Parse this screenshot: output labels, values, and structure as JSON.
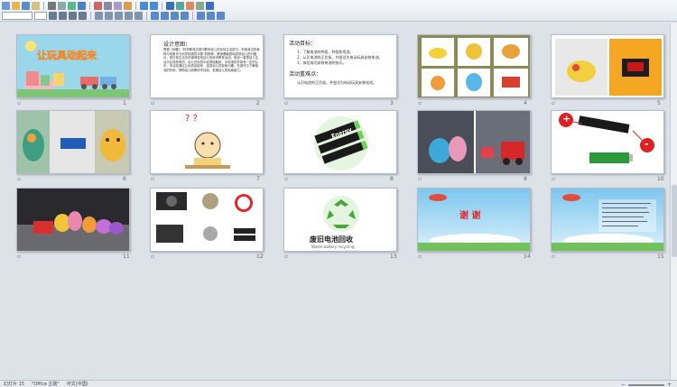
{
  "toolbar": {
    "row1_icons": [
      "new-icon",
      "open-icon",
      "save-icon",
      "mail-icon",
      "print-icon",
      "print-preview-icon",
      "spell-icon",
      "research-icon",
      "cut-icon",
      "copy-icon",
      "paste-icon",
      "format-painter-icon",
      "undo-icon",
      "redo-icon",
      "hyperlink-icon",
      "table-icon",
      "chart-icon",
      "zoom-icon",
      "help-icon"
    ],
    "row2_icons": [
      "bold-icon",
      "italic-icon",
      "underline-icon",
      "shadow-icon",
      "align-left-icon",
      "align-center-icon",
      "align-right-icon",
      "numbering-icon",
      "bullets-icon",
      "font-size-up-icon",
      "font-size-down-icon",
      "indent-icon",
      "outdent-icon",
      "font-color-icon",
      "design-icon",
      "new-slide-icon"
    ]
  },
  "slides": [
    {
      "num": "1",
      "title": "让玩具动起来"
    },
    {
      "num": "2",
      "heading": "设计意图：",
      "body": "根据《纲要》\"科学教育应密切联系幼儿的实际生活进行，利用身边的事物与现象作为科学探索的对象\"的精神，教师要敏锐地发现幼儿的兴趣点，把日常生活中的事情变成幼儿的科学教育活动。电池一直是幼儿生活中比较熟悉的，幼儿在玩具中经常接触到，对电池的作用有一定的认识，本活动通过让玩具动起来，激发幼儿的探索兴趣，在操作中了解电池的作用，帮助幼儿积累科学经验，发展幼儿的探索能力。"
    },
    {
      "num": "3",
      "heading": "活动目标：",
      "items": [
        "1、了解电池的种类、种类和用途。",
        "2、认识电池的正负极，并尝试为电动玩具安装电池。",
        "3、体验成功安装电池的快乐。"
      ],
      "heading2": "活动重难点：",
      "body2": "认识电池的正负极，并尝试为电动玩具安装电池。"
    },
    {
      "num": "4"
    },
    {
      "num": "5"
    },
    {
      "num": "6"
    },
    {
      "num": "7",
      "text": "? ?"
    },
    {
      "num": "8",
      "label": "Energy"
    },
    {
      "num": "9"
    },
    {
      "num": "10",
      "plus": "+",
      "minus": "-"
    },
    {
      "num": "11"
    },
    {
      "num": "12"
    },
    {
      "num": "13",
      "title": "废旧电池回收",
      "subtitle": "Waste battery recycling"
    },
    {
      "num": "14",
      "title": "谢 谢"
    },
    {
      "num": "15"
    }
  ],
  "status": {
    "slide_info": "幻灯片 15",
    "theme": "\"Office 主题\"",
    "language": "中文(中国)"
  }
}
